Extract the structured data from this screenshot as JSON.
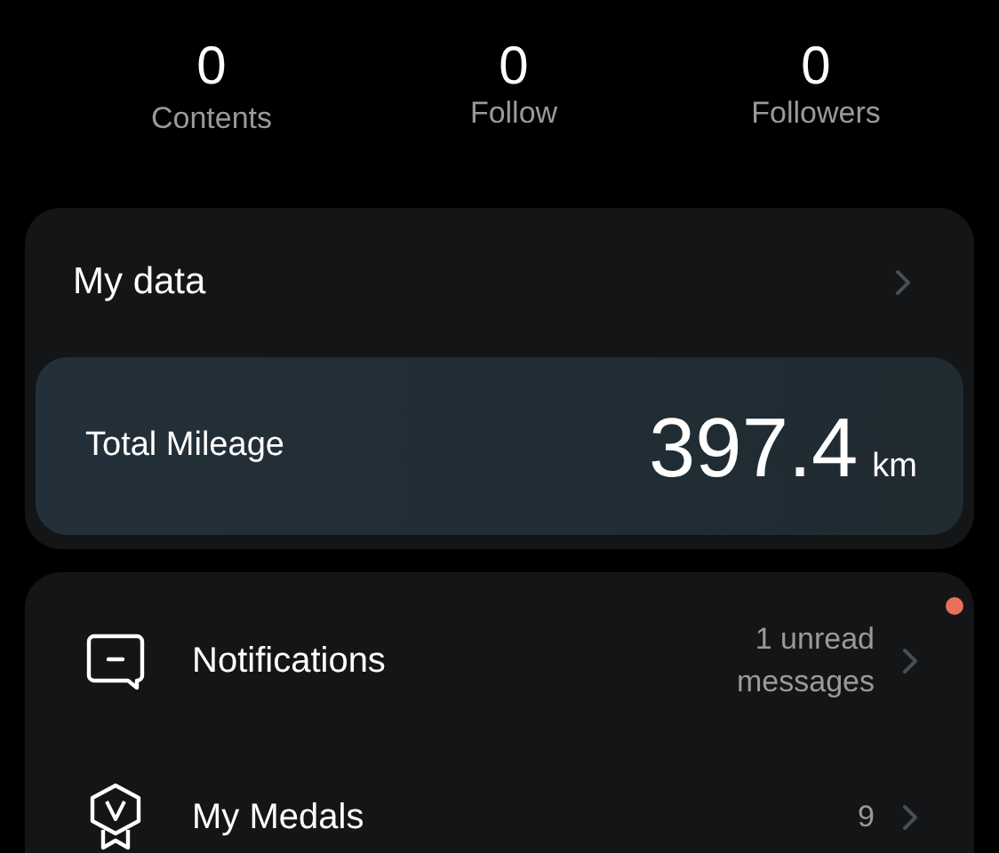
{
  "stats": [
    {
      "value": "0",
      "label": "Contents"
    },
    {
      "value": "0",
      "label": "Follow"
    },
    {
      "value": "0",
      "label": "Followers"
    }
  ],
  "my_data": {
    "title": "My data",
    "mileage": {
      "label": "Total Mileage",
      "value": "397.4",
      "unit": "km"
    }
  },
  "menu": [
    {
      "kind": "notifications",
      "label": "Notifications",
      "detail": "1 unread messages",
      "dot": true
    },
    {
      "kind": "medals",
      "label": "My Medals",
      "detail": "9",
      "dot": false
    }
  ]
}
